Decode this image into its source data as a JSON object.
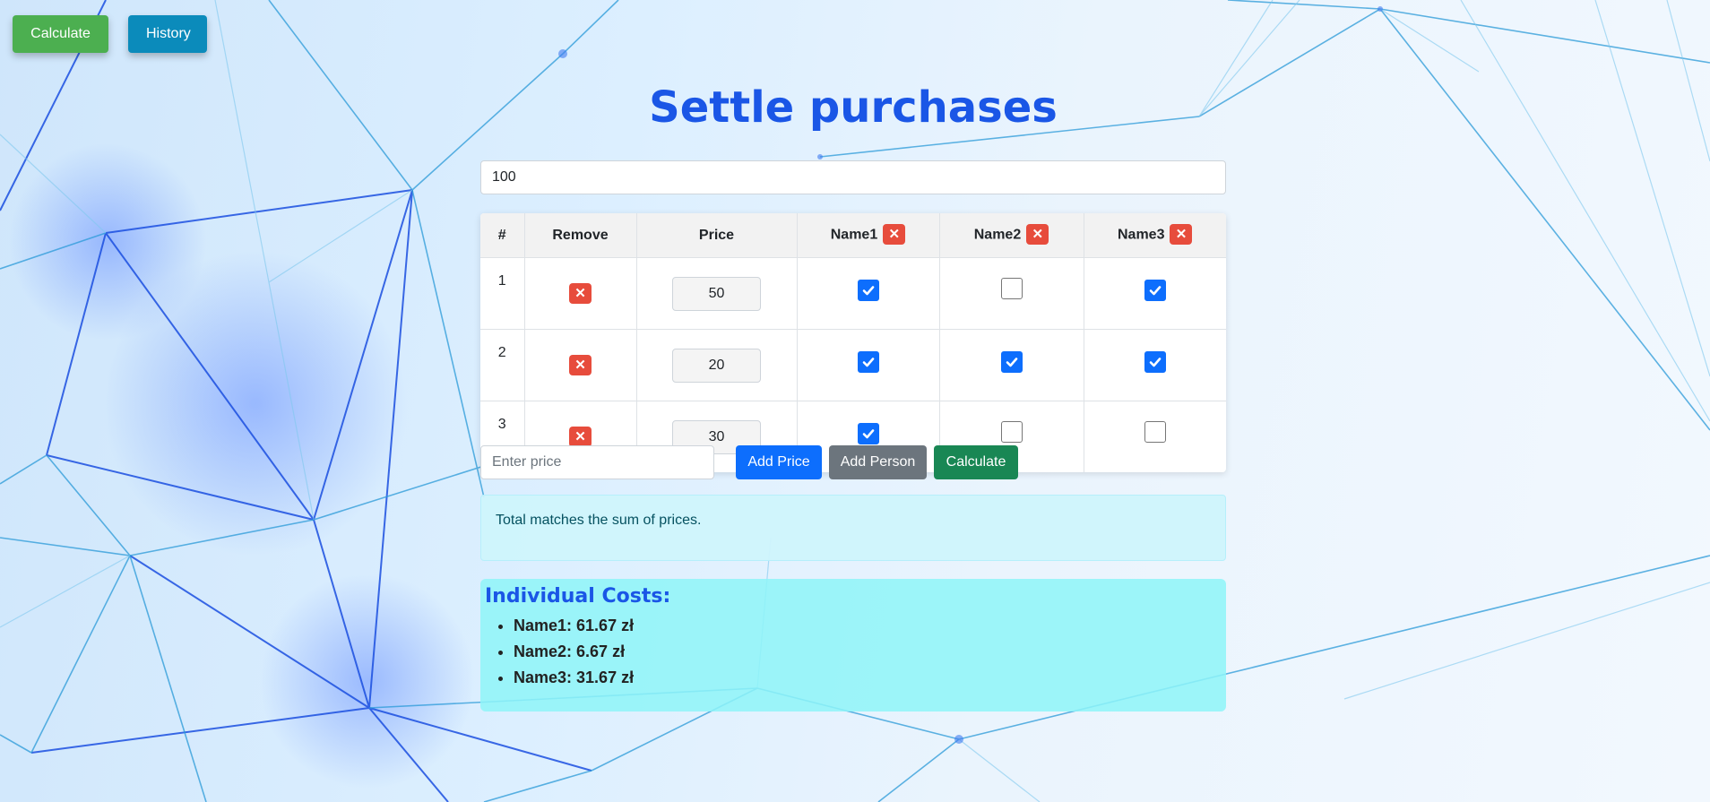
{
  "nav": {
    "calculate_label": "Calculate",
    "history_label": "History"
  },
  "page": {
    "title": "Settle purchases"
  },
  "total_input": {
    "value": "100"
  },
  "table": {
    "headers": {
      "index": "#",
      "remove": "Remove",
      "price": "Price"
    },
    "people": [
      {
        "name": "Name1"
      },
      {
        "name": "Name2"
      },
      {
        "name": "Name3"
      }
    ],
    "remove_glyph": "✕",
    "rows": [
      {
        "num": "1",
        "price": "50",
        "checks": [
          true,
          false,
          true
        ]
      },
      {
        "num": "2",
        "price": "20",
        "checks": [
          true,
          true,
          true
        ]
      },
      {
        "num": "3",
        "price": "30",
        "checks": [
          true,
          false,
          false
        ]
      }
    ]
  },
  "controls": {
    "price_placeholder": "Enter price",
    "add_price_label": "Add Price",
    "add_person_label": "Add Person",
    "calculate_label": "Calculate"
  },
  "status": {
    "message": "Total matches the sum of prices."
  },
  "results": {
    "title": "Individual Costs:",
    "items": [
      "Name1: 61.67 zł",
      "Name2: 6.67 zł",
      "Name3: 31.67 zł"
    ]
  },
  "colors": {
    "accent": "#1a56e6",
    "delete": "#e74c3c",
    "checkbox_on": "#0d6efd",
    "nav_calculate": "#4caf50",
    "nav_history": "#0b8bbb",
    "add_price": "#0d6efd",
    "add_person": "#6c757d",
    "calculate": "#198754"
  }
}
